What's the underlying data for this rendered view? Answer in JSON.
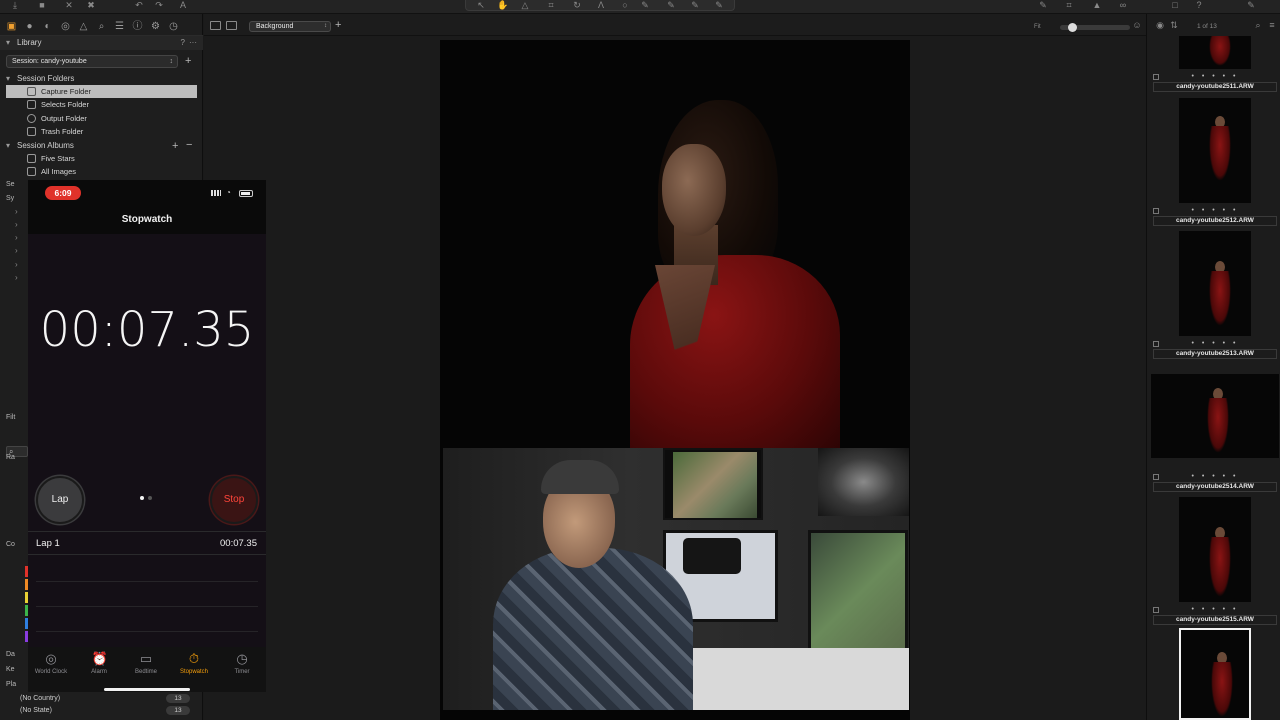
{
  "viewer": {
    "background_label": "Background",
    "fit_label": "Fit"
  },
  "library": {
    "title": "Library",
    "help": "?",
    "more": "···",
    "session": "Session: candy-youtube",
    "session_folders_title": "Session Folders",
    "folders": [
      "Capture Folder",
      "Selects Folder",
      "Output Folder",
      "Trash Folder"
    ],
    "albums_title": "Session Albums",
    "albums": [
      "Five Stars",
      "All Images"
    ],
    "truncated_rows": [
      "Se",
      "Sy"
    ],
    "filter_title": "Filt",
    "rating_title": "Ra",
    "color_title": "Co",
    "date_title": "Da",
    "keyword_title": "Ke",
    "place_title": "Pla",
    "place_rows": [
      {
        "label": "(No Country)",
        "count": "13"
      },
      {
        "label": "(No State)",
        "count": "13"
      }
    ],
    "color_tags": [
      "#e0322a",
      "#f08a24",
      "#e8d034",
      "#3cb44a",
      "#2f7fe0",
      "#8a3ce0"
    ]
  },
  "phone": {
    "status_time": "6:09",
    "title": "Stopwatch",
    "elapsed": "00:07.35",
    "lap_button": "Lap",
    "stop_button": "Stop",
    "laps": [
      {
        "name": "Lap 1",
        "time": "00:07.35"
      }
    ],
    "tabs": [
      {
        "label": "World Clock",
        "icon": "globe-icon",
        "glyph": "◎"
      },
      {
        "label": "Alarm",
        "icon": "alarm-clock-icon",
        "glyph": "⏰"
      },
      {
        "label": "Bedtime",
        "icon": "bed-icon",
        "glyph": "▭"
      },
      {
        "label": "Stopwatch",
        "icon": "stopwatch-icon",
        "glyph": "⏱"
      },
      {
        "label": "Timer",
        "icon": "timer-icon",
        "glyph": "◷"
      }
    ],
    "active_tab": "Stopwatch",
    "accent": "#f59e0b",
    "stop_color": "#ff453a"
  },
  "browser": {
    "counter": "1 of 13",
    "thumbs": [
      {
        "name": "candy-youtube2511.ARW",
        "stars": "• • • • •"
      },
      {
        "name": "candy-youtube2512.ARW",
        "stars": "• • • • •"
      },
      {
        "name": "candy-youtube2513.ARW",
        "stars": "• • • • •"
      },
      {
        "name": "candy-youtube2514.ARW",
        "stars": "• • • • •"
      },
      {
        "name": "candy-youtube2515.ARW",
        "stars": "• • • • •"
      }
    ]
  }
}
